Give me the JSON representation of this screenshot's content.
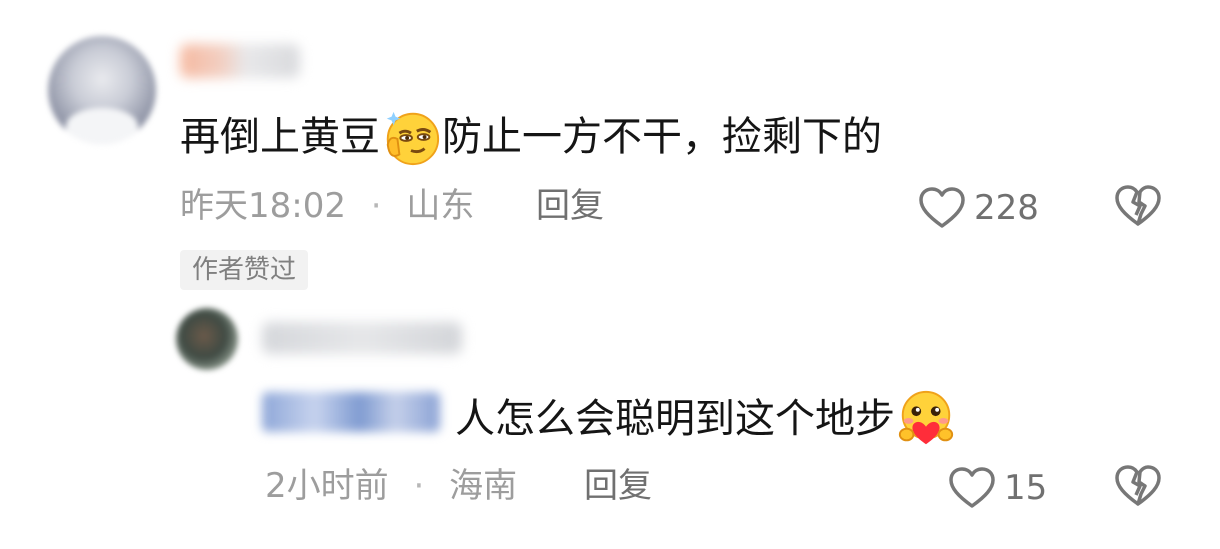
{
  "comment": {
    "text_before_emoji": "再倒上黄豆",
    "emoji": "smirk-thinking-emoji",
    "text_after_emoji": "防止一方不干，捡剩下的",
    "time": "昨天18:02",
    "separator": "·",
    "location": "山东",
    "reply_label": "回复",
    "like_count": "228",
    "author_liked_tag": "作者赞过"
  },
  "reply": {
    "text": "人怎么会聪明到这个地步",
    "emoji": "heart-hug-emoji",
    "time": "2小时前",
    "separator": "·",
    "location": "海南",
    "reply_label": "回复",
    "like_count": "15"
  },
  "colors": {
    "text": "#151515",
    "meta": "#9d9d9d",
    "action": "#707070",
    "tag_bg": "#f2f2f2"
  }
}
